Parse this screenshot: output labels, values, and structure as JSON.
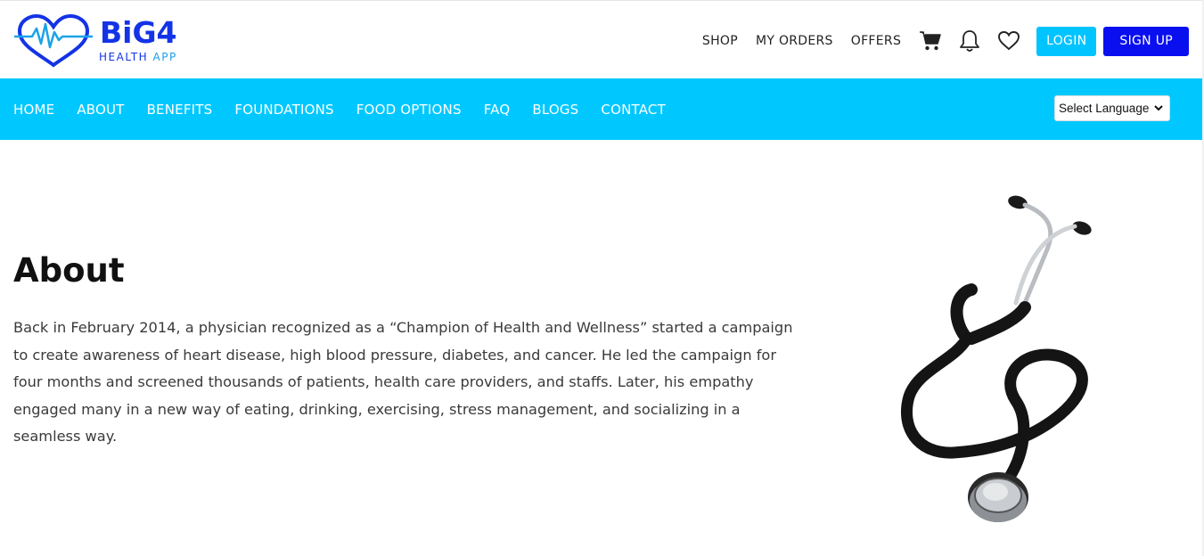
{
  "brand": {
    "name": "BiG4",
    "tagline_part1": "HEALTH",
    "tagline_part2": "APP",
    "colors": {
      "primary": "#1433e6",
      "accent": "#00c8ff"
    }
  },
  "topnav": {
    "links": [
      "SHOP",
      "MY ORDERS",
      "OFFERS"
    ],
    "icons": [
      "cart-icon",
      "bell-icon",
      "heart-icon"
    ],
    "login_label": "LOGIN",
    "signup_label": "SIGN UP"
  },
  "mainnav": {
    "items": [
      "HOME",
      "ABOUT",
      "BENEFITS",
      "FOUNDATIONS",
      "FOOD OPTIONS",
      "FAQ",
      "BLOGS",
      "CONTACT"
    ],
    "background": "#00c8ff"
  },
  "language_select": {
    "selected": "Select Language"
  },
  "about": {
    "title": "About",
    "body": "Back in February 2014, a physician recognized as a “Champion of Health and Wellness” started a campaign to create awareness of heart disease, high blood pressure, diabetes, and cancer. He led the campaign for four months and screened thousands of patients, health care providers, and staffs. Later, his empathy engaged many in a new way of eating, drinking, exercising, stress management, and socializing in a seamless way."
  }
}
